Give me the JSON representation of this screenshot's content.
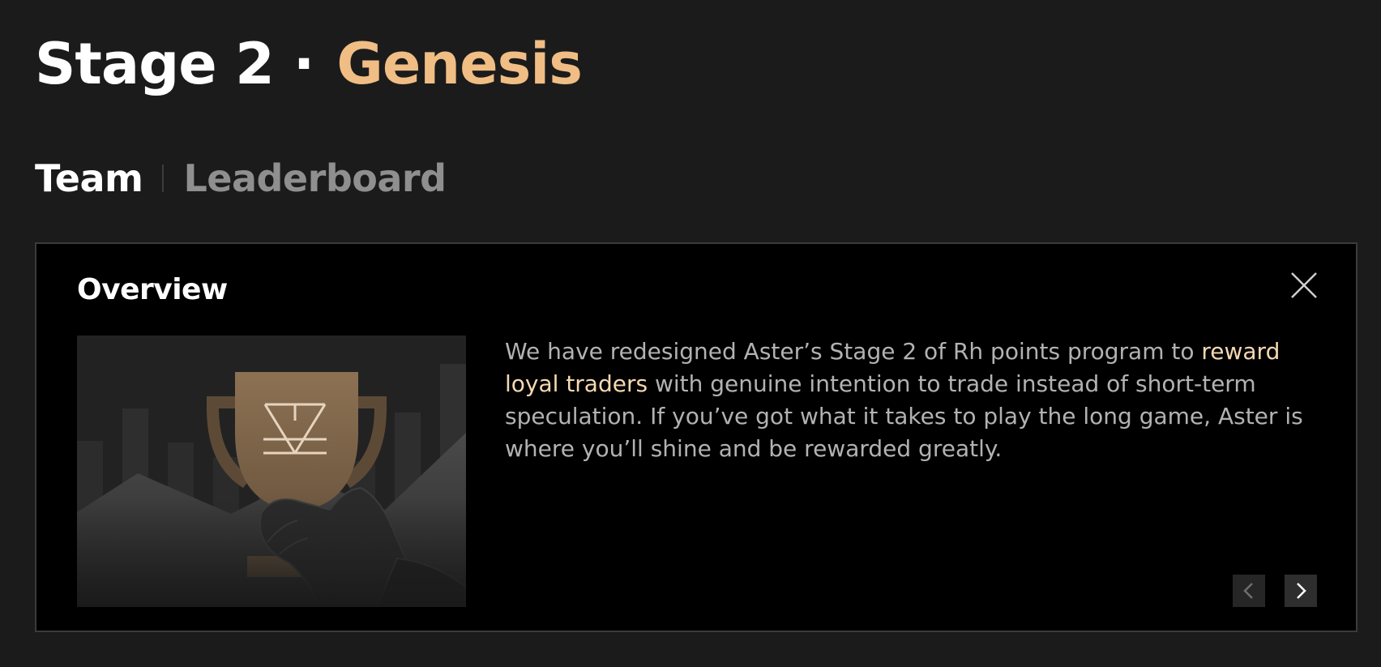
{
  "header": {
    "stage_label": "Stage 2",
    "separator": "·",
    "stage_name": "Genesis",
    "accent_color": "#f0bd84"
  },
  "tabs": [
    {
      "label": "Team",
      "active": true
    },
    {
      "label": "Leaderboard",
      "active": false
    }
  ],
  "overview": {
    "title": "Overview",
    "text_before": "We have redesigned Aster’s Stage 2 of Rh points program to ",
    "text_highlight": "reward loyal traders",
    "text_after": " with genuine intention to trade instead of short-term speculation. If you’ve got what it takes to play the long game, Aster is where you’ll shine and be rewarded greatly.",
    "highlight_color": "#f6d8b3",
    "illustration_icon": "trophy-icon",
    "close_icon": "close-icon",
    "prev_icon": "chevron-left-icon",
    "next_icon": "chevron-right-icon"
  }
}
